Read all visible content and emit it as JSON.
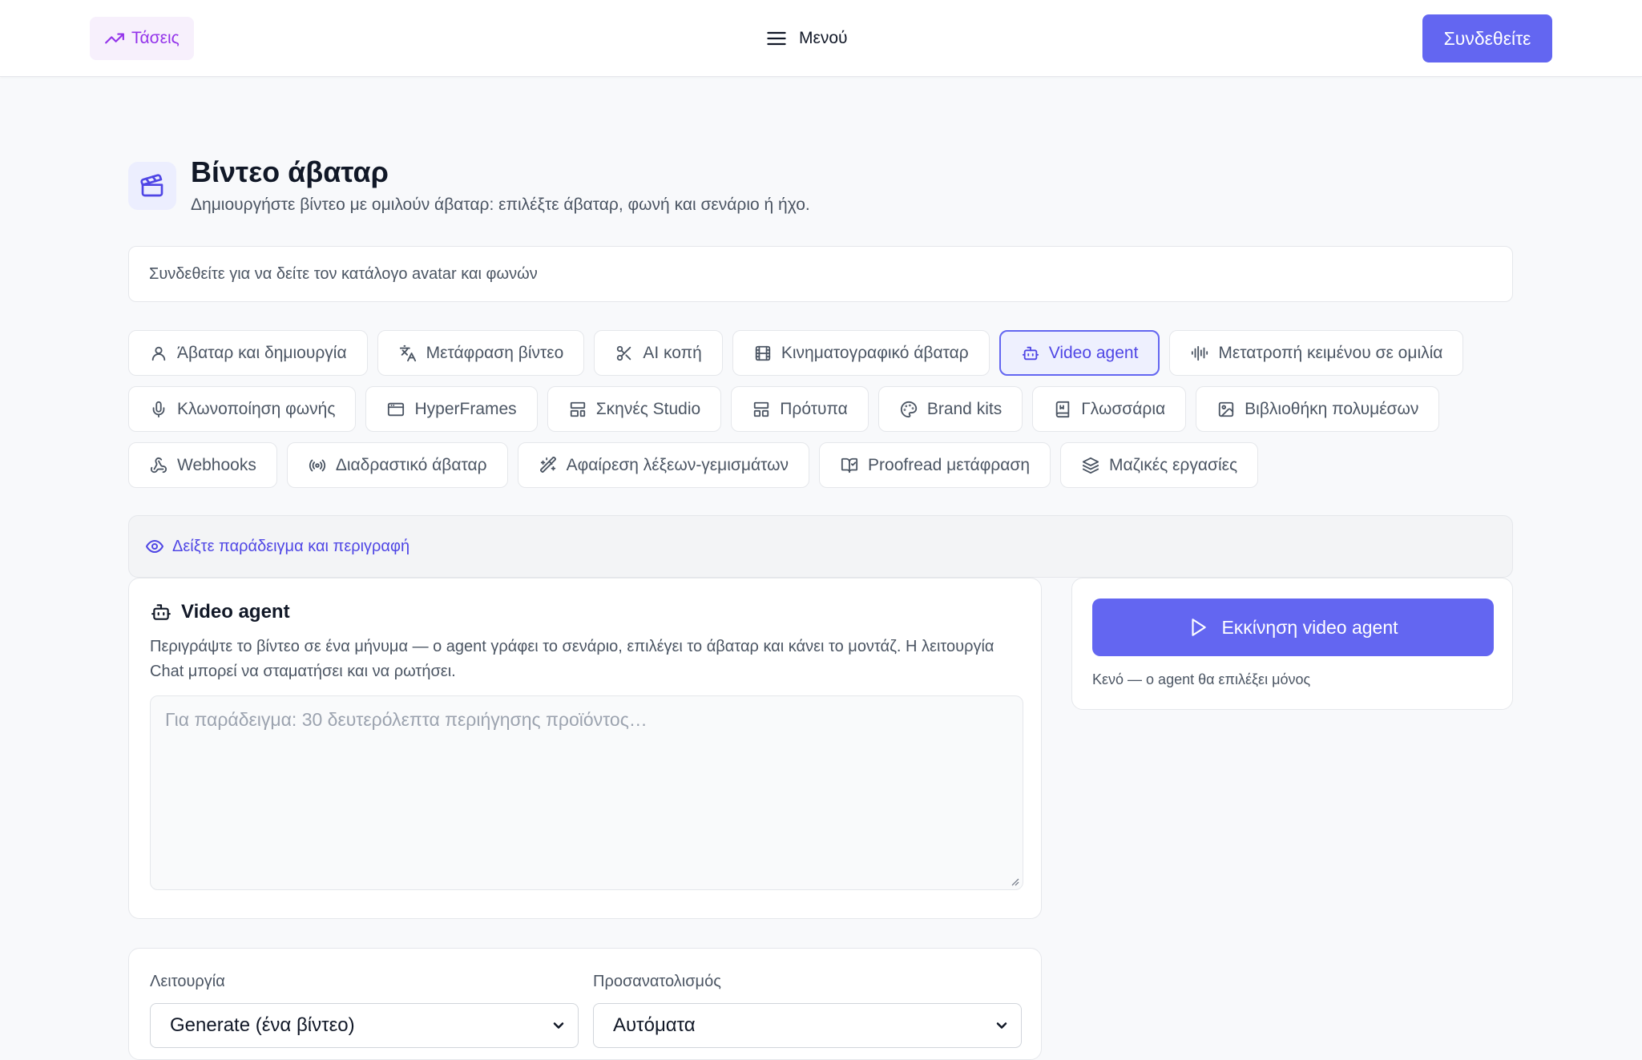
{
  "header": {
    "trends_label": "Τάσεις",
    "menu_label": "Μενού",
    "login_label": "Συνδεθείτε"
  },
  "page": {
    "title": "Βίντεο άβαταρ",
    "subtitle": "Δημιουργήστε βίντεο με ομιλούν άβαταρ: επιλέξτε άβαταρ, φωνή και σενάριο ή ήχο."
  },
  "notice": "Συνδεθείτε για να δείτε τον κατάλογο avatar και φωνών",
  "tabs": [
    {
      "label": "Άβαταρ και δημιουργία",
      "icon": "user-icon"
    },
    {
      "label": "Μετάφραση βίντεο",
      "icon": "translate-icon"
    },
    {
      "label": "AI κοπή",
      "icon": "scissors-icon"
    },
    {
      "label": "Κινηματογραφικό άβαταρ",
      "icon": "film-icon"
    },
    {
      "label": "Video agent",
      "icon": "bot-icon",
      "active": true
    },
    {
      "label": "Μετατροπή κειμένου σε ομιλία",
      "icon": "audio-lines-icon"
    },
    {
      "label": "Κλωνοποίηση φωνής",
      "icon": "mic-icon"
    },
    {
      "label": "HyperFrames",
      "icon": "browser-icon"
    },
    {
      "label": "Σκηνές Studio",
      "icon": "layout-icon"
    },
    {
      "label": "Πρότυπα",
      "icon": "template-icon"
    },
    {
      "label": "Brand kits",
      "icon": "palette-icon"
    },
    {
      "label": "Γλωσσάρια",
      "icon": "book-icon"
    },
    {
      "label": "Βιβλιοθήκη πολυμέσων",
      "icon": "image-icon"
    },
    {
      "label": "Webhooks",
      "icon": "webhook-icon"
    },
    {
      "label": "Διαδραστικό άβαταρ",
      "icon": "radio-icon"
    },
    {
      "label": "Αφαίρεση λέξεων-γεμισμάτων",
      "icon": "wand-icon"
    },
    {
      "label": "Proofread μετάφραση",
      "icon": "book-check-icon"
    },
    {
      "label": "Μαζικές εργασίες",
      "icon": "layers-icon"
    }
  ],
  "example_toggle": "Δείξτε παράδειγμα και περιγραφή",
  "agent": {
    "title": "Video agent",
    "description": "Περιγράψτε το βίντεο σε ένα μήνυμα — ο agent γράφει το σενάριο, επιλέγει το άβαταρ και κάνει το μοντάζ. Η λειτουργία Chat μπορεί να σταματήσει και να ρωτήσει.",
    "prompt_placeholder": "Για παράδειγμα: 30 δευτερόλεπτα περιήγησης προϊόντος…",
    "prompt_value": ""
  },
  "run": {
    "button_label": "Εκκίνηση video agent",
    "hint": "Κενό — ο agent θα επιλέξει μόνος"
  },
  "settings": {
    "mode_label": "Λειτουργία",
    "mode_value": "Generate (ένα βίντεο)",
    "orientation_label": "Προσανατολισμός",
    "orientation_value": "Αυτόματα"
  },
  "colors": {
    "accent": "#6366f1",
    "trends": "#9333ea"
  }
}
